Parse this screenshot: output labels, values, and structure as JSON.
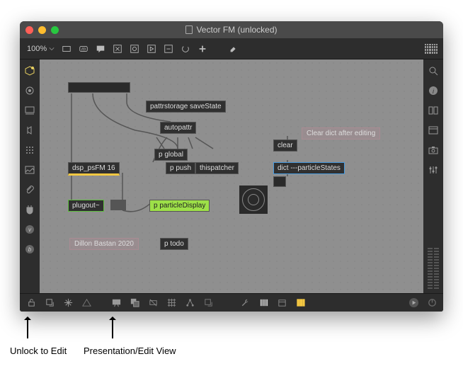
{
  "window": {
    "title": "Vector FM (unlocked)"
  },
  "toolbar": {
    "zoom": "100%"
  },
  "objects": {
    "pattrstorage": "pattrstorage saveState",
    "autopattr": "autopattr",
    "p_global": "p global",
    "dsp": "dsp_psFM 16",
    "p_push": "p push",
    "thispatcher": "thispatcher",
    "clear": "clear",
    "dict": "dict ---particleStates",
    "plugout": "plugout~",
    "p_particle": "p particleDisplay",
    "p_todo": "p todo"
  },
  "comments": {
    "clear_dict": "Clear dict after editing",
    "credit": "Dillon Bastan 2020"
  },
  "annotations": {
    "unlock": "Unlock to Edit",
    "presentation": "Presentation/Edit View"
  }
}
